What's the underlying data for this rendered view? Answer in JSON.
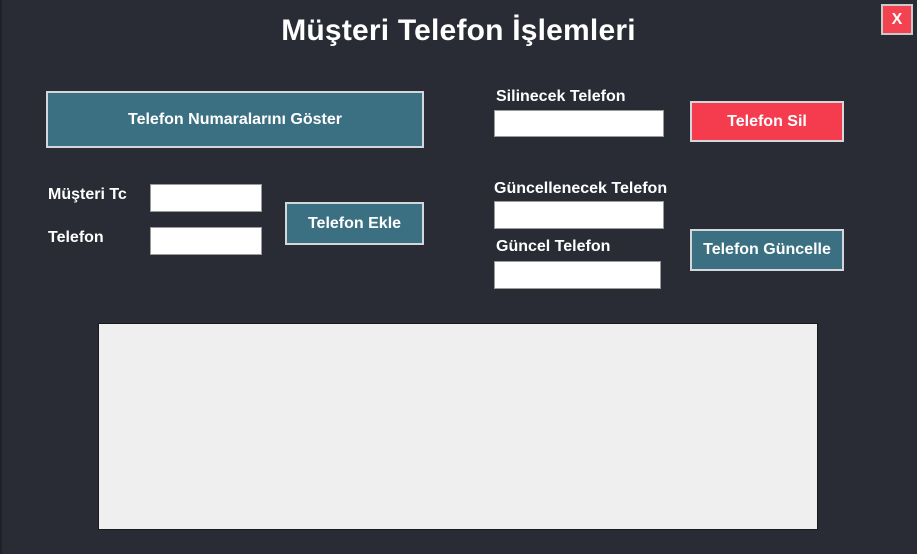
{
  "window": {
    "title": "Müşteri Telefon İşlemleri",
    "close_label": "X"
  },
  "show_numbers": {
    "button_label": "Telefon Numaralarını Göster"
  },
  "add_phone": {
    "customer_tc_label": "Müşteri Tc",
    "customer_tc_value": "",
    "phone_label": "Telefon",
    "phone_value": "",
    "button_label": "Telefon Ekle"
  },
  "delete_phone": {
    "label": "Silinecek Telefon",
    "value": "",
    "button_label": "Telefon Sil"
  },
  "update_phone": {
    "old_label": "Güncellenecek Telefon",
    "old_value": "",
    "new_label": "Güncel Telefon",
    "new_value": "",
    "button_label": "Telefon Güncelle"
  },
  "results_grid": {
    "rows": []
  },
  "colors": {
    "background": "#292c35",
    "primary_button": "#3b6f82",
    "danger_button": "#f43c4e",
    "grid_background": "#efefef"
  }
}
